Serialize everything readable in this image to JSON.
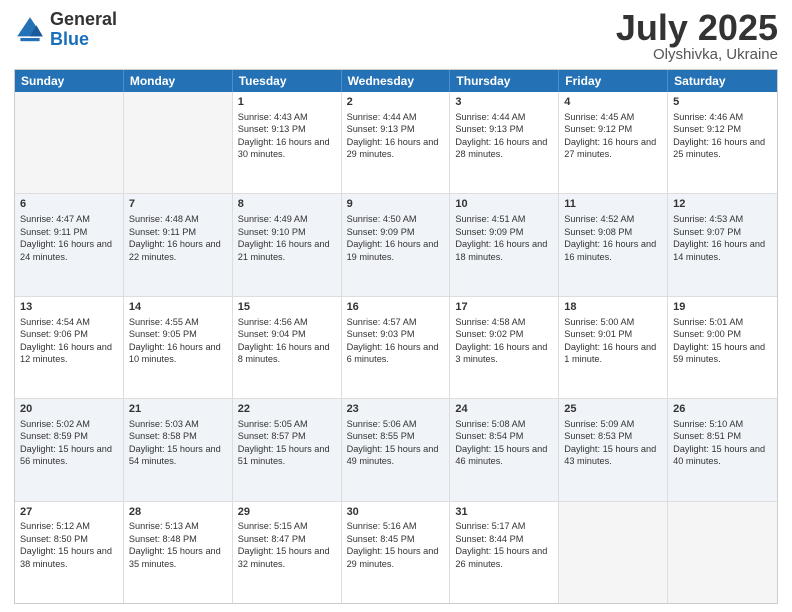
{
  "logo": {
    "general": "General",
    "blue": "Blue"
  },
  "title": "July 2025",
  "subtitle": "Olyshivka, Ukraine",
  "weekdays": [
    "Sunday",
    "Monday",
    "Tuesday",
    "Wednesday",
    "Thursday",
    "Friday",
    "Saturday"
  ],
  "rows": [
    [
      {
        "day": "",
        "info": ""
      },
      {
        "day": "",
        "info": ""
      },
      {
        "day": "1",
        "info": "Sunrise: 4:43 AM\nSunset: 9:13 PM\nDaylight: 16 hours and 30 minutes."
      },
      {
        "day": "2",
        "info": "Sunrise: 4:44 AM\nSunset: 9:13 PM\nDaylight: 16 hours and 29 minutes."
      },
      {
        "day": "3",
        "info": "Sunrise: 4:44 AM\nSunset: 9:13 PM\nDaylight: 16 hours and 28 minutes."
      },
      {
        "day": "4",
        "info": "Sunrise: 4:45 AM\nSunset: 9:12 PM\nDaylight: 16 hours and 27 minutes."
      },
      {
        "day": "5",
        "info": "Sunrise: 4:46 AM\nSunset: 9:12 PM\nDaylight: 16 hours and 25 minutes."
      }
    ],
    [
      {
        "day": "6",
        "info": "Sunrise: 4:47 AM\nSunset: 9:11 PM\nDaylight: 16 hours and 24 minutes."
      },
      {
        "day": "7",
        "info": "Sunrise: 4:48 AM\nSunset: 9:11 PM\nDaylight: 16 hours and 22 minutes."
      },
      {
        "day": "8",
        "info": "Sunrise: 4:49 AM\nSunset: 9:10 PM\nDaylight: 16 hours and 21 minutes."
      },
      {
        "day": "9",
        "info": "Sunrise: 4:50 AM\nSunset: 9:09 PM\nDaylight: 16 hours and 19 minutes."
      },
      {
        "day": "10",
        "info": "Sunrise: 4:51 AM\nSunset: 9:09 PM\nDaylight: 16 hours and 18 minutes."
      },
      {
        "day": "11",
        "info": "Sunrise: 4:52 AM\nSunset: 9:08 PM\nDaylight: 16 hours and 16 minutes."
      },
      {
        "day": "12",
        "info": "Sunrise: 4:53 AM\nSunset: 9:07 PM\nDaylight: 16 hours and 14 minutes."
      }
    ],
    [
      {
        "day": "13",
        "info": "Sunrise: 4:54 AM\nSunset: 9:06 PM\nDaylight: 16 hours and 12 minutes."
      },
      {
        "day": "14",
        "info": "Sunrise: 4:55 AM\nSunset: 9:05 PM\nDaylight: 16 hours and 10 minutes."
      },
      {
        "day": "15",
        "info": "Sunrise: 4:56 AM\nSunset: 9:04 PM\nDaylight: 16 hours and 8 minutes."
      },
      {
        "day": "16",
        "info": "Sunrise: 4:57 AM\nSunset: 9:03 PM\nDaylight: 16 hours and 6 minutes."
      },
      {
        "day": "17",
        "info": "Sunrise: 4:58 AM\nSunset: 9:02 PM\nDaylight: 16 hours and 3 minutes."
      },
      {
        "day": "18",
        "info": "Sunrise: 5:00 AM\nSunset: 9:01 PM\nDaylight: 16 hours and 1 minute."
      },
      {
        "day": "19",
        "info": "Sunrise: 5:01 AM\nSunset: 9:00 PM\nDaylight: 15 hours and 59 minutes."
      }
    ],
    [
      {
        "day": "20",
        "info": "Sunrise: 5:02 AM\nSunset: 8:59 PM\nDaylight: 15 hours and 56 minutes."
      },
      {
        "day": "21",
        "info": "Sunrise: 5:03 AM\nSunset: 8:58 PM\nDaylight: 15 hours and 54 minutes."
      },
      {
        "day": "22",
        "info": "Sunrise: 5:05 AM\nSunset: 8:57 PM\nDaylight: 15 hours and 51 minutes."
      },
      {
        "day": "23",
        "info": "Sunrise: 5:06 AM\nSunset: 8:55 PM\nDaylight: 15 hours and 49 minutes."
      },
      {
        "day": "24",
        "info": "Sunrise: 5:08 AM\nSunset: 8:54 PM\nDaylight: 15 hours and 46 minutes."
      },
      {
        "day": "25",
        "info": "Sunrise: 5:09 AM\nSunset: 8:53 PM\nDaylight: 15 hours and 43 minutes."
      },
      {
        "day": "26",
        "info": "Sunrise: 5:10 AM\nSunset: 8:51 PM\nDaylight: 15 hours and 40 minutes."
      }
    ],
    [
      {
        "day": "27",
        "info": "Sunrise: 5:12 AM\nSunset: 8:50 PM\nDaylight: 15 hours and 38 minutes."
      },
      {
        "day": "28",
        "info": "Sunrise: 5:13 AM\nSunset: 8:48 PM\nDaylight: 15 hours and 35 minutes."
      },
      {
        "day": "29",
        "info": "Sunrise: 5:15 AM\nSunset: 8:47 PM\nDaylight: 15 hours and 32 minutes."
      },
      {
        "day": "30",
        "info": "Sunrise: 5:16 AM\nSunset: 8:45 PM\nDaylight: 15 hours and 29 minutes."
      },
      {
        "day": "31",
        "info": "Sunrise: 5:17 AM\nSunset: 8:44 PM\nDaylight: 15 hours and 26 minutes."
      },
      {
        "day": "",
        "info": ""
      },
      {
        "day": "",
        "info": ""
      }
    ]
  ]
}
